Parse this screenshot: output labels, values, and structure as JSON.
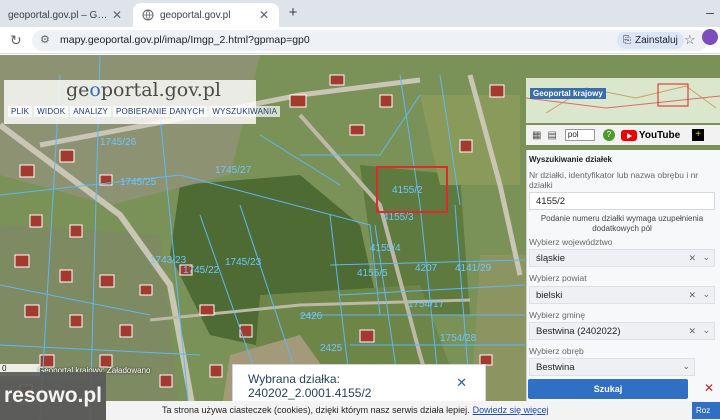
{
  "browser": {
    "tabs": [
      {
        "title": "geoportal.gov.pl – Geoportal Krajowy",
        "active": false
      },
      {
        "title": "geoportal.gov.pl",
        "active": true
      }
    ],
    "url": "mapy.geoportal.gov.pl/imap/Imgp_2.html?gpmap=gp0",
    "install_label": "Zainstaluj"
  },
  "app": {
    "logo_pre": "ge",
    "logo_o": "o",
    "logo_post": "portal.gov.pl",
    "menu": [
      "PLIK",
      "WIDOK",
      "ANALIZY",
      "POBIERANIE DANYCH",
      "WYSZUKIWANIA"
    ],
    "minimap_title": "Geoportal krajowy",
    "lang_value": "pol",
    "youtube_label": "YouTube"
  },
  "map_labels": [
    "1745/27",
    "4155/2",
    "1745/23",
    "1745/22",
    "4155/4",
    "4155/5",
    "1745/26",
    "1745/25",
    "4155/3",
    "4207",
    "1754/17",
    "4141/29",
    "2426",
    "1743/23",
    "1754/28",
    "2425"
  ],
  "search_panel": {
    "title": "Wyszukiwanie działek",
    "id_label": "Nr działki, identyfikator lub nazwa obrębu i nr działki",
    "id_value": "4155/2",
    "note": "Podanie numeru działki wymaga uzupełnienia dodatkowych pól",
    "voivodeship_label": "Wybierz województwo",
    "voivodeship_value": "śląskie",
    "county_label": "Wybierz powiat",
    "county_value": "bielski",
    "commune_label": "Wybierz gminę",
    "commune_value": "Bestwina (2402022)",
    "precinct_label": "Wybierz obręb",
    "precinct_value": "Bestwina",
    "search_button": "Szukaj"
  },
  "status": {
    "scale_text": "0 ",
    "loading_text": "Geoportal krajowy: Załadowano"
  },
  "toast": {
    "line1": "Wybrana działka:",
    "line2": "240202_2.0001.4155/2"
  },
  "watermark": "resowo.pl",
  "cookie": {
    "text": "Ta strona używa ciasteczek (cookies), dzięki którym nasz serwis działa lepiej.",
    "link": "Dowiedz się więcej",
    "ok": "Roz"
  }
}
